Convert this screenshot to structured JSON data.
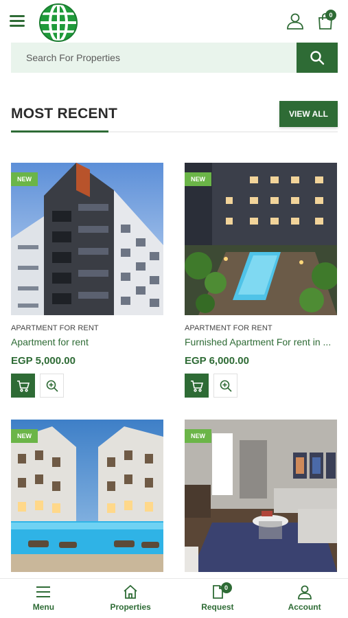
{
  "header": {
    "cart_count": "0"
  },
  "search": {
    "placeholder": "Search For Properties"
  },
  "section": {
    "title": "MOST RECENT",
    "view_all_label": "VIEW ALL"
  },
  "listings": [
    {
      "badge": "NEW",
      "category": "APARTMENT FOR RENT",
      "title": "Apartment for rent",
      "price": "EGP 5,000.00"
    },
    {
      "badge": "NEW",
      "category": "APARTMENT FOR RENT",
      "title": "Furnished Apartment For rent in ...",
      "price": "EGP 6,000.00"
    },
    {
      "badge": "NEW"
    },
    {
      "badge": "NEW"
    }
  ],
  "bottom_nav": {
    "items": [
      {
        "label": "Menu",
        "icon": "menu-icon"
      },
      {
        "label": "Properties",
        "icon": "home-icon"
      },
      {
        "label": "Request",
        "icon": "request-icon",
        "badge": "0"
      },
      {
        "label": "Account",
        "icon": "user-icon"
      }
    ]
  },
  "colors": {
    "primary": "#2e6b35",
    "badge": "#6bb548",
    "search_bg": "#e9f4ec"
  }
}
